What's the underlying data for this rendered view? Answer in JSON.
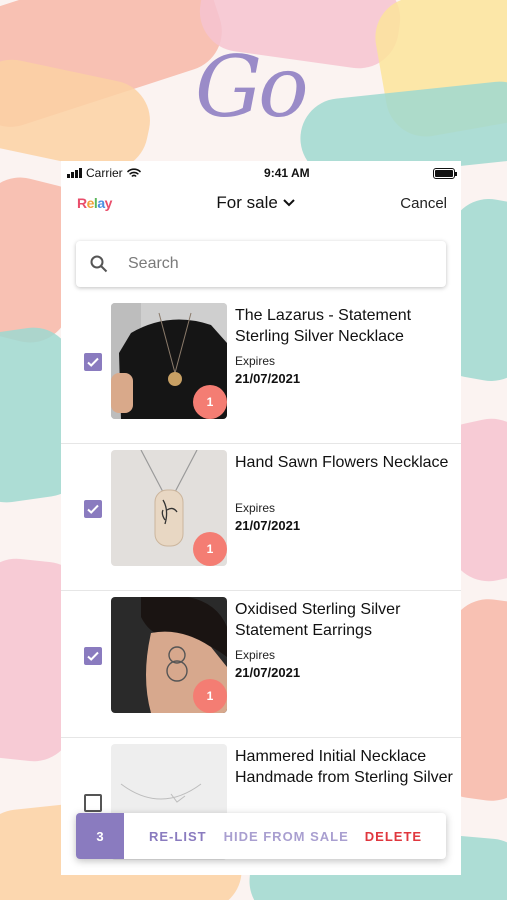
{
  "background": {
    "logo_text": "Go",
    "colors": [
      "#f7b7a8",
      "#9fd8d0",
      "#fbe49b",
      "#f6c3d0",
      "#fbd1a3"
    ]
  },
  "status_bar": {
    "carrier": "Carrier",
    "time": "9:41 AM"
  },
  "nav": {
    "brand": "Relay",
    "title": "For sale",
    "cancel_label": "Cancel"
  },
  "search": {
    "placeholder": "Search"
  },
  "listings": [
    {
      "title": "The Lazarus - Statement Sterling Silver Necklace",
      "expires_label": "Expires",
      "expires_date": "21/07/2021",
      "quantity": "1",
      "selected": true
    },
    {
      "title": "Hand Sawn Flowers Necklace",
      "expires_label": "Expires",
      "expires_date": "21/07/2021",
      "quantity": "1",
      "selected": true
    },
    {
      "title": "Oxidised Sterling Silver Statement Earrings",
      "expires_label": "Expires",
      "expires_date": "21/07/2021",
      "quantity": "1",
      "selected": true
    },
    {
      "title": "Hammered Initial Necklace Handmade from Sterling Silver",
      "selected": false
    }
  ],
  "action_bar": {
    "selected_count": "3",
    "relist_label": "RE-LIST",
    "hide_label": "HIDE FROM SALE",
    "delete_label": "DELETE"
  },
  "colors": {
    "accent": "#8a7bbf",
    "badge": "#f47d73",
    "delete": "#e0373e"
  }
}
